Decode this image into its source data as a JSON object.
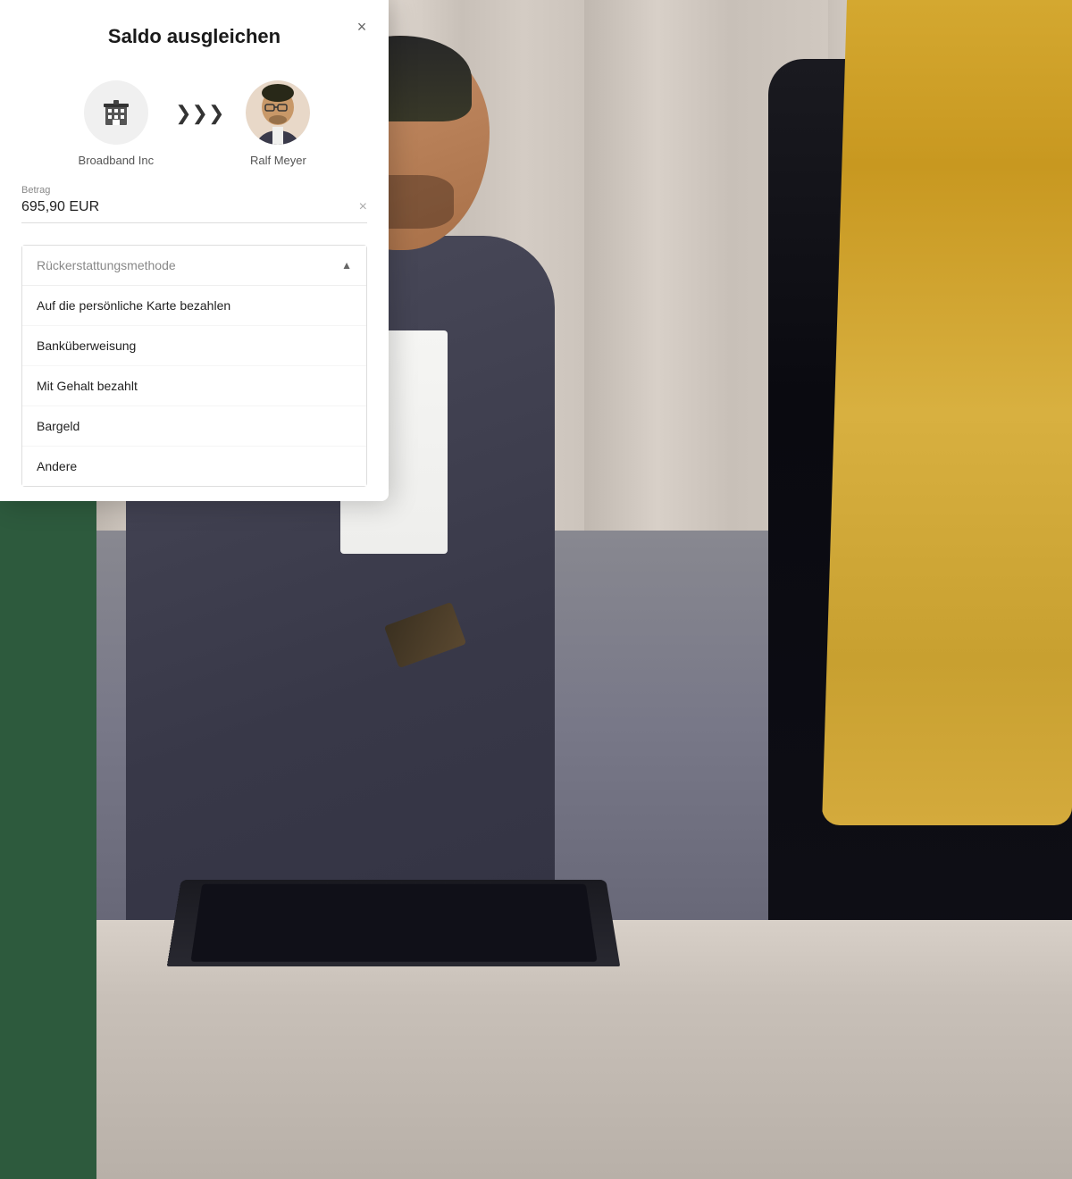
{
  "modal": {
    "title": "Saldo ausgleichen",
    "close_label": "×",
    "from_entity": {
      "label": "Broadband Inc",
      "icon_type": "building"
    },
    "arrow_icon": "❯❯❯",
    "to_entity": {
      "label": "Ralf Meyer",
      "icon_type": "avatar"
    },
    "amount_field": {
      "label": "Betrag",
      "value": "695,90 EUR",
      "clear_icon": "×"
    },
    "dropdown": {
      "label": "Rückerstattungsmethode",
      "arrow_open": "▲",
      "options": [
        {
          "id": "card",
          "label": "Auf die persönliche Karte bezahlen"
        },
        {
          "id": "bank",
          "label": "Banküberweisung"
        },
        {
          "id": "salary",
          "label": "Mit Gehalt bezahlt"
        },
        {
          "id": "cash",
          "label": "Bargeld"
        },
        {
          "id": "other",
          "label": "Andere"
        }
      ]
    }
  },
  "background": {
    "green_strip_color": "#2d5a3d"
  }
}
